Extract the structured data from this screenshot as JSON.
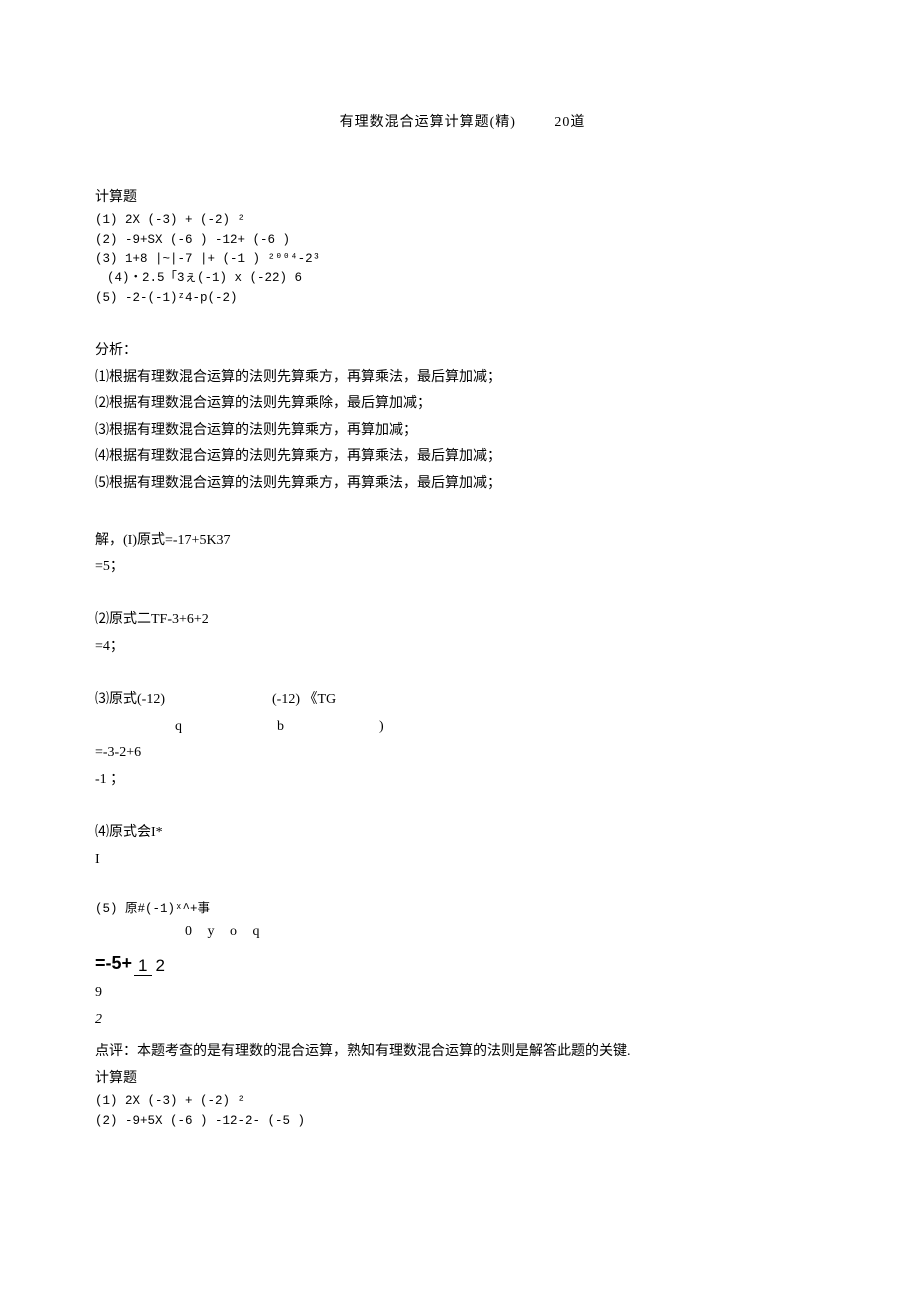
{
  "title_main": "有理数混合运算计算题(精)",
  "title_count": "20道",
  "sec1_header": "计算题",
  "sec1_lines": [
    "(1) 2X (-3) + (-2) ²",
    "(2) -9+SX (-6 ) -12+ (-6 )",
    "(3) 1+8 |~|-7 |+ (-1 ) ²⁰⁰⁴-2³",
    " (4)・2.5「3ぇ(-1) x (-22) 6",
    "(5) -2-(-1)ᶻ4-p(-2)"
  ],
  "sec2_header": "分析：",
  "sec2_lines": [
    "⑴根据有理数混合运算的法则先算乘方，再算乘法，最后算加减；",
    "⑵根据有理数混合运算的法则先算乘除，最后算加减；",
    "⑶根据有理数混合运算的法则先算乘方，再算加减；",
    "⑷根据有理数混合运算的法则先算乘方，再算乘法，最后算加减；",
    "⑸根据有理数混合运算的法则先算乘方，再算乘法，最后算加减；"
  ],
  "sol_head": "解，(I)原式=-17+5K37",
  "sol_head_b": "=5；",
  "sol2a": "⑵原式二TF-3+6+2",
  "sol2b": "=4；",
  "sol3a": "⑶原式(-12)",
  "sol3a2": "(-12) 《TG",
  "sol3b": "q",
  "sol3b2": "b",
  "sol3b3": ")",
  "sol3c": "=-3-2+6",
  "sol3d": "-1 ；",
  "sol4a": "⑷原式会I*",
  "sol4b": "I",
  "sol5a": "(5) 原#(-1)ˣ^+事",
  "sol5b": "0 y o q",
  "frac_prefix": "=-5+",
  "frac_num": "1",
  "frac_den": "2",
  "sol5d": "9",
  "sol5e": "2",
  "comment": "点评：本题考查的是有理数的混合运算，熟知有理数混合运算的法则是解答此题的关键.",
  "sec3_header": "计算题",
  "sec3_lines": [
    "(1) 2X (-3) + (-2) ²",
    "(2) -9+5X (-6 ) -12-2- (-5 )"
  ]
}
